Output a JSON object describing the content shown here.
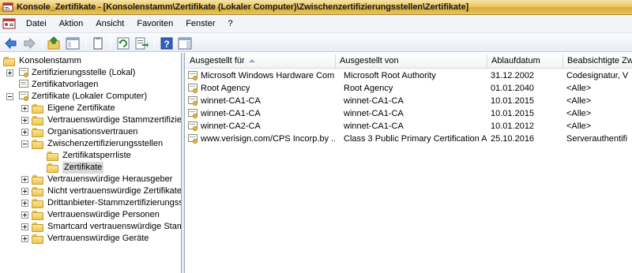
{
  "window": {
    "title": "Konsole_Zertifikate - [Konsolenstamm\\Zertifikate (Lokaler Computer)\\Zwischenzertifizierungsstellen\\Zertifikate]"
  },
  "menu": {
    "items": [
      "Datei",
      "Aktion",
      "Ansicht",
      "Favoriten",
      "Fenster",
      "?"
    ]
  },
  "toolbar": {
    "buttons": [
      "back-arrow-icon",
      "forward-arrow-icon",
      "up-folder-icon",
      "show-hide-tree-icon",
      "copy-icon",
      "refresh-icon",
      "export-list-icon",
      "help-icon",
      "properties-pane-icon"
    ]
  },
  "tree": {
    "root": "Konsolenstamm",
    "items": [
      "Zertifizierungsstelle (Lokal)",
      "Zertifikatvorlagen",
      "Zertifikate (Lokaler Computer)",
      "Eigene Zertifikate",
      "Vertrauenswürdige Stammzertifizieru",
      "Organisationsvertrauen",
      "Zwischenzertifizierungsstellen",
      "Zertifikatsperrliste",
      "Zertifikate",
      "Vertrauenswürdige Herausgeber",
      "Nicht vertrauenswürdige Zertifikate",
      "Drittanbieter-Stammzertifizierungsst",
      "Vertrauenswürdige Personen",
      "Smartcard vertrauenswürdige Stamm",
      "Vertrauenswürdige Geräte"
    ]
  },
  "list": {
    "columns": [
      "Ausgestellt für",
      "Ausgestellt von",
      "Ablaufdatum",
      "Beabsichtigte Zw"
    ],
    "rows": [
      [
        "Microsoft Windows Hardware Com...",
        "Microsoft Root Authority",
        "31.12.2002",
        "Codesignatur, V"
      ],
      [
        "Root Agency",
        "Root Agency",
        "01.01.2040",
        "<Alle>"
      ],
      [
        "winnet-CA1-CA",
        "winnet-CA1-CA",
        "10.01.2015",
        "<Alle>"
      ],
      [
        "winnet-CA1-CA",
        "winnet-CA1-CA",
        "10.01.2015",
        "<Alle>"
      ],
      [
        "winnet-CA2-CA",
        "winnet-CA1-CA",
        "10.01.2012",
        "<Alle>"
      ],
      [
        "www.verisign.com/CPS Incorp.by ...",
        "Class 3 Public Primary Certification A...",
        "25.10.2016",
        "Serverauthentifi"
      ]
    ]
  },
  "colors": {
    "titlebar": "#e9c764",
    "folder": "#eec557",
    "selection": "#d9d9d9"
  }
}
